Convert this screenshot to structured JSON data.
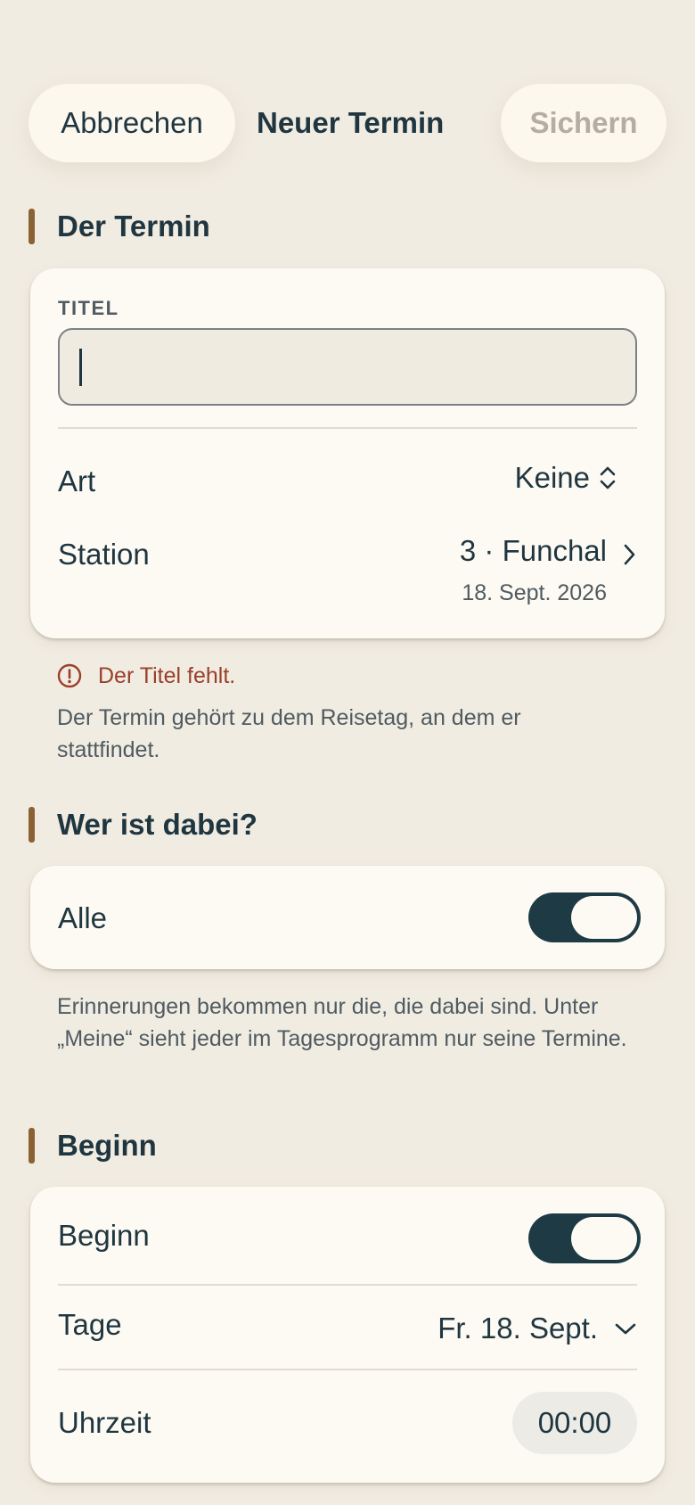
{
  "header": {
    "cancel_label": "Abbrechen",
    "title": "Neuer Termin",
    "save_label": "Sichern"
  },
  "section_termin": {
    "title": "Der Termin",
    "title_field_label": "TITEL",
    "title_value": "",
    "art_label": "Art",
    "art_value": "Keine",
    "station_label": "Station",
    "station_value": "3 · Funchal",
    "station_date": "18. Sept. 2026",
    "error": "Der Titel fehlt.",
    "note": "Der Termin gehört zu dem Reisetag, an dem er stattfindet."
  },
  "section_participants": {
    "title": "Wer ist dabei?",
    "all_label": "Alle",
    "all_enabled": true,
    "note": "Erinnerungen bekommen nur die, die dabei sind. Unter „Meine“ sieht jeder im Tagesprogramm nur seine Termine."
  },
  "section_begin": {
    "title": "Beginn",
    "begin_label": "Beginn",
    "begin_enabled": true,
    "days_label": "Tage",
    "days_value": "Fr. 18. Sept.",
    "time_label": "Uhrzeit",
    "time_value": "00:00"
  },
  "icons": {
    "updown": "chevron-up-down-icon",
    "chevron_right": "chevron-right-icon",
    "chevron_down": "chevron-down-icon",
    "error": "exclamation-circle-icon"
  },
  "colors": {
    "background": "#f1ece2",
    "card": "#fdfaf3",
    "accent_bar": "#8a6235",
    "toggle_on": "#1e3a44",
    "error": "#9a3f2a",
    "text_primary": "#1f3640",
    "text_secondary": "#4f5b61",
    "save_disabled": "#b3ada2"
  }
}
